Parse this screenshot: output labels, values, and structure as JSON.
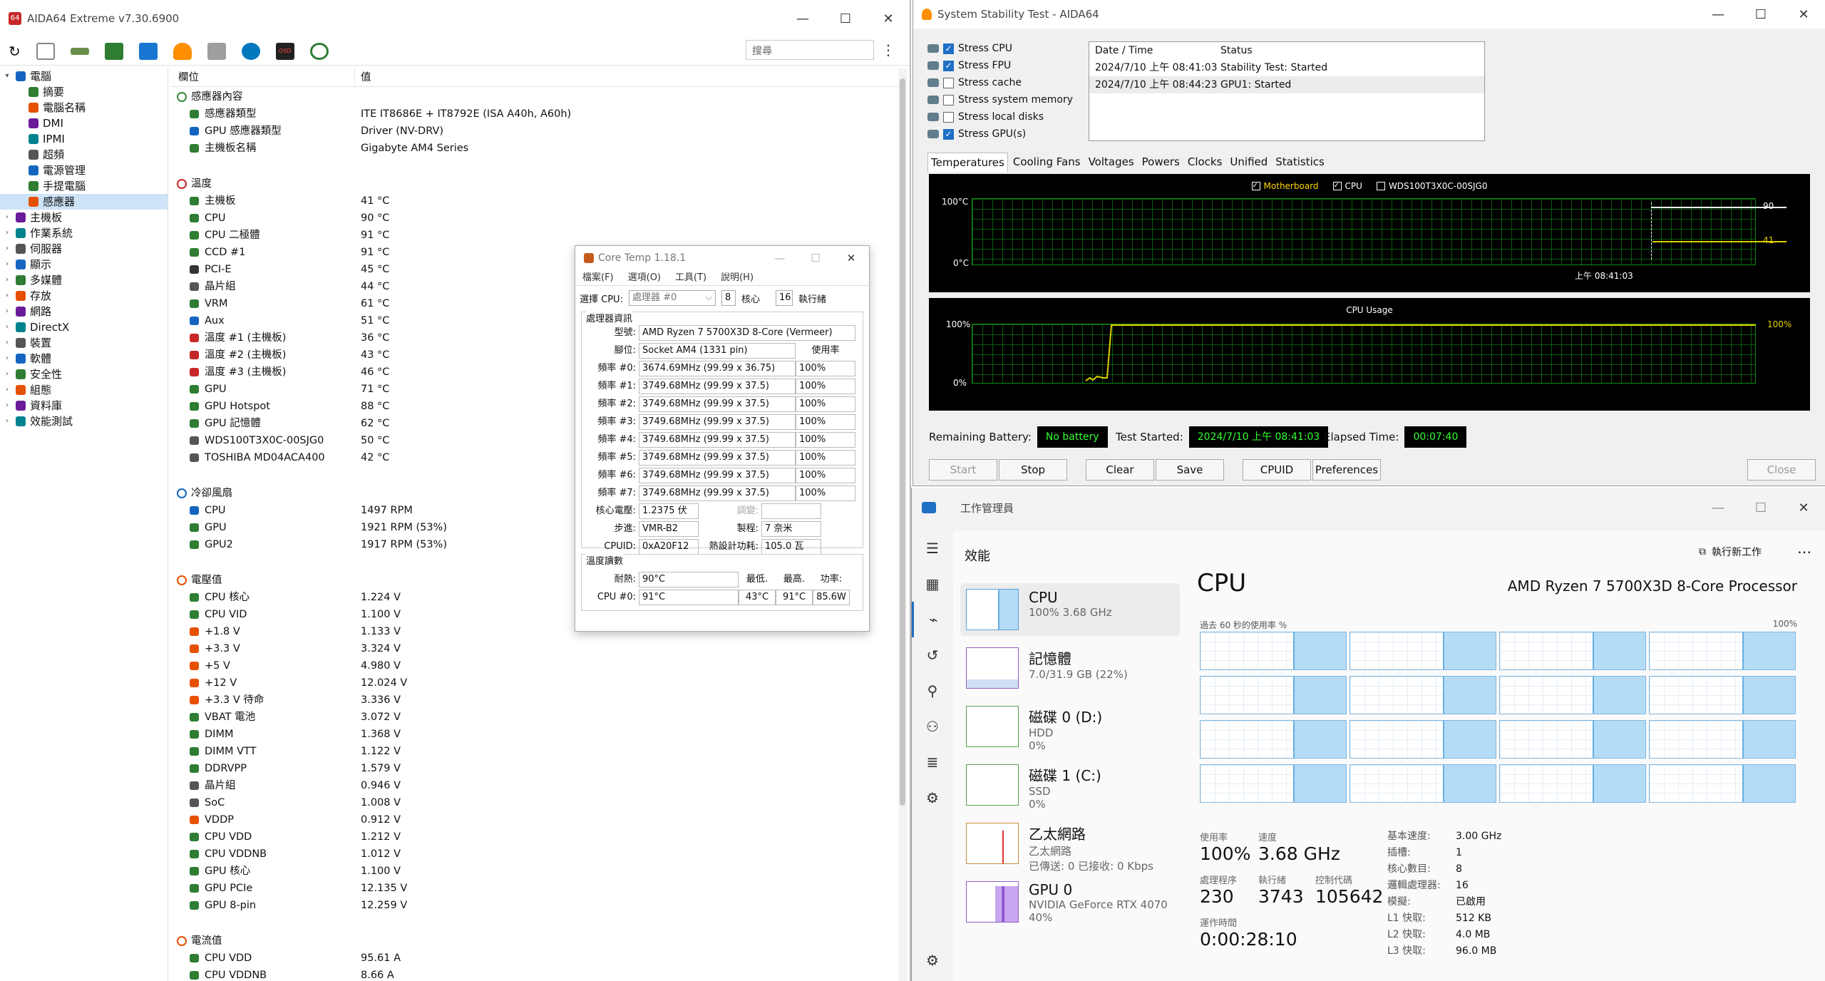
{
  "aida": {
    "title": "AIDA64 Extreme v7.30.6900",
    "search_placeholder": "搜尋",
    "col_field": "欄位",
    "col_value": "值",
    "tree": [
      {
        "label": "電腦",
        "icon": "computer-icon",
        "expand": "v",
        "indent": 0
      },
      {
        "label": "摘要",
        "icon": "summary-icon",
        "indent": 1
      },
      {
        "label": "電腦名稱",
        "icon": "computer-name-icon",
        "indent": 1
      },
      {
        "label": "DMI",
        "icon": "dmi-icon",
        "indent": 1
      },
      {
        "label": "IPMI",
        "icon": "ipmi-icon",
        "indent": 1
      },
      {
        "label": "超頻",
        "icon": "overclock-icon",
        "indent": 1
      },
      {
        "label": "電源管理",
        "icon": "power-icon",
        "indent": 1
      },
      {
        "label": "手提電腦",
        "icon": "laptop-icon",
        "indent": 1
      },
      {
        "label": "感應器",
        "icon": "sensor-icon",
        "indent": 1,
        "selected": true
      },
      {
        "label": "主機板",
        "icon": "motherboard-icon",
        "expand": ">",
        "indent": 0
      },
      {
        "label": "作業系統",
        "icon": "windows-icon",
        "expand": ">",
        "indent": 0
      },
      {
        "label": "伺服器",
        "icon": "server-icon",
        "expand": ">",
        "indent": 0
      },
      {
        "label": "顯示",
        "icon": "display-icon",
        "expand": ">",
        "indent": 0
      },
      {
        "label": "多媒體",
        "icon": "multimedia-icon",
        "expand": ">",
        "indent": 0
      },
      {
        "label": "存放",
        "icon": "storage-icon",
        "expand": ">",
        "indent": 0
      },
      {
        "label": "網路",
        "icon": "network-icon",
        "expand": ">",
        "indent": 0
      },
      {
        "label": "DirectX",
        "icon": "directx-icon",
        "expand": ">",
        "indent": 0
      },
      {
        "label": "裝置",
        "icon": "devices-icon",
        "expand": ">",
        "indent": 0
      },
      {
        "label": "軟體",
        "icon": "software-icon",
        "expand": ">",
        "indent": 0
      },
      {
        "label": "安全性",
        "icon": "security-icon",
        "expand": ">",
        "indent": 0
      },
      {
        "label": "組態",
        "icon": "config-icon",
        "expand": ">",
        "indent": 0
      },
      {
        "label": "資料庫",
        "icon": "database-icon",
        "expand": ">",
        "indent": 0
      },
      {
        "label": "效能測試",
        "icon": "benchmark-icon",
        "expand": ">",
        "indent": 0
      }
    ],
    "groups": [
      {
        "title": "感應器內容",
        "icon": "sensor-icon",
        "color": "#3a8a3a",
        "rows": [
          [
            "感應器類型",
            "ITE IT8686E + IT8792E  (ISA A40h, A60h)",
            "#2e7d32"
          ],
          [
            "GPU 感應器類型",
            "Driver  (NV-DRV)",
            "#1565c0"
          ],
          [
            "主機板名稱",
            "Gigabyte AM4 Series",
            "#2e7d32"
          ]
        ]
      },
      {
        "title": "溫度",
        "icon": "thermometer-icon",
        "color": "#c62828",
        "rows": [
          [
            "主機板",
            "41 °C",
            "#2e7d32"
          ],
          [
            "CPU",
            "90 °C",
            "#2e7d32"
          ],
          [
            "CPU 二極體",
            "91 °C",
            "#2e7d32"
          ],
          [
            "CCD #1",
            "91 °C",
            "#2e7d32"
          ],
          [
            "PCI-E",
            "45 °C",
            "#333"
          ],
          [
            "晶片組",
            "44 °C",
            "#555"
          ],
          [
            "VRM",
            "61 °C",
            "#2e7d32"
          ],
          [
            "Aux",
            "51 °C",
            "#1565c0"
          ],
          [
            "溫度 #1 (主機板)",
            "36 °C",
            "#c62828"
          ],
          [
            "溫度 #2 (主機板)",
            "43 °C",
            "#c62828"
          ],
          [
            "溫度 #3 (主機板)",
            "46 °C",
            "#c62828"
          ],
          [
            "GPU",
            "71 °C",
            "#2e7d32"
          ],
          [
            "GPU Hotspot",
            "88 °C",
            "#2e7d32"
          ],
          [
            "GPU 記憶體",
            "62 °C",
            "#2e7d32"
          ],
          [
            "WDS100T3X0C-00SJG0",
            "50 °C",
            "#555"
          ],
          [
            "TOSHIBA MD04ACA400",
            "42 °C",
            "#555"
          ]
        ]
      },
      {
        "title": "冷卻風扇",
        "icon": "fan-icon",
        "color": "#1565c0",
        "rows": [
          [
            "CPU",
            "1497 RPM",
            "#1565c0"
          ],
          [
            "GPU",
            "1921 RPM  (53%)",
            "#2e7d32"
          ],
          [
            "GPU2",
            "1917 RPM  (53%)",
            "#2e7d32"
          ]
        ]
      },
      {
        "title": "電壓值",
        "icon": "voltage-icon",
        "color": "#e65100",
        "rows": [
          [
            "CPU 核心",
            "1.224 V",
            "#2e7d32"
          ],
          [
            "CPU VID",
            "1.100 V",
            "#2e7d32"
          ],
          [
            "+1.8 V",
            "1.133 V",
            "#e65100"
          ],
          [
            "+3.3 V",
            "3.324 V",
            "#e65100"
          ],
          [
            "+5 V",
            "4.980 V",
            "#e65100"
          ],
          [
            "+12 V",
            "12.024 V",
            "#e65100"
          ],
          [
            "+3.3 V 待命",
            "3.336 V",
            "#e65100"
          ],
          [
            "VBAT 電池",
            "3.072 V",
            "#2e7d32"
          ],
          [
            "DIMM",
            "1.368 V",
            "#2e7d32"
          ],
          [
            "DIMM VTT",
            "1.122 V",
            "#2e7d32"
          ],
          [
            "DDRVPP",
            "1.579 V",
            "#2e7d32"
          ],
          [
            "晶片組",
            "0.946 V",
            "#555"
          ],
          [
            "SoC",
            "1.008 V",
            "#555"
          ],
          [
            "VDDP",
            "0.912 V",
            "#e65100"
          ],
          [
            "CPU VDD",
            "1.212 V",
            "#2e7d32"
          ],
          [
            "CPU VDDNB",
            "1.012 V",
            "#2e7d32"
          ],
          [
            "GPU 核心",
            "1.100 V",
            "#2e7d32"
          ],
          [
            "GPU PCIe",
            "12.135 V",
            "#2e7d32"
          ],
          [
            "GPU 8-pin",
            "12.259 V",
            "#2e7d32"
          ]
        ]
      },
      {
        "title": "電流值",
        "icon": "current-icon",
        "color": "#e65100",
        "rows": [
          [
            "CPU VDD",
            "95.61 A",
            "#2e7d32"
          ],
          [
            "CPU VDDNB",
            "8.66 A",
            "#2e7d32"
          ]
        ]
      }
    ]
  },
  "coretemp": {
    "title": "Core Temp 1.18.1",
    "menu": [
      "檔案(F)",
      "選項(O)",
      "工具(T)",
      "說明(H)"
    ],
    "select_label": "選擇 CPU:",
    "select_value": "處理器 #0",
    "cores_num": "8",
    "cores_label": "核心",
    "threads_num": "16",
    "threads_label": "執行緒",
    "info_legend": "處理器資訊",
    "model_label": "型號:",
    "model_value": "AMD Ryzen 7 5700X3D 8-Core (Vermeer)",
    "socket_label": "腳位:",
    "socket_value": "Socket AM4 (1331 pin)",
    "usage_header": "使用率",
    "freqs": [
      [
        "頻率 #0:",
        "3674.69MHz (99.99 x 36.75)",
        "100%"
      ],
      [
        "頻率 #1:",
        "3749.68MHz (99.99 x 37.5)",
        "100%"
      ],
      [
        "頻率 #2:",
        "3749.68MHz (99.99 x 37.5)",
        "100%"
      ],
      [
        "頻率 #3:",
        "3749.68MHz (99.99 x 37.5)",
        "100%"
      ],
      [
        "頻率 #4:",
        "3749.68MHz (99.99 x 37.5)",
        "100%"
      ],
      [
        "頻率 #5:",
        "3749.68MHz (99.99 x 37.5)",
        "100%"
      ],
      [
        "頻率 #6:",
        "3749.68MHz (99.99 x 37.5)",
        "100%"
      ],
      [
        "頻率 #7:",
        "3749.68MHz (99.99 x 37.5)",
        "100%"
      ]
    ],
    "vcore_label": "核心電壓:",
    "vcore_value": "1.2375 伏",
    "mod_label": "調變:",
    "step_label": "步進:",
    "step_value": "VMR-B2",
    "proc_label": "製程:",
    "proc_value": "7 奈米",
    "cpuid_label": "CPUID:",
    "cpuid_value": "0xA20F12",
    "tdp_label": "熱設計功耗:",
    "tdp_value": "105.0 瓦",
    "temp_legend": "溫度讀數",
    "tj_label": "耐熱:",
    "tj_value": "90°C",
    "min_label": "最低.",
    "max_label": "最高.",
    "power_label": "功率:",
    "cpu0_label": "CPU #0:",
    "cpu0_value": "91°C",
    "cpu0_min": "43°C",
    "cpu0_max": "91°C",
    "cpu0_power": "85.6W"
  },
  "sst": {
    "title": "System Stability Test - AIDA64",
    "stress": [
      {
        "label": "Stress CPU",
        "checked": true,
        "icon": "cpu-icon"
      },
      {
        "label": "Stress FPU",
        "checked": true,
        "icon": "fpu-icon"
      },
      {
        "label": "Stress cache",
        "checked": false,
        "icon": "cache-icon"
      },
      {
        "label": "Stress system memory",
        "checked": false,
        "icon": "memory-icon"
      },
      {
        "label": "Stress local disks",
        "checked": false,
        "icon": "disk-icon"
      },
      {
        "label": "Stress GPU(s)",
        "checked": true,
        "icon": "gpu-icon"
      }
    ],
    "log_headers": [
      "Date / Time",
      "Status"
    ],
    "log": [
      [
        "2024/7/10 上午 08:41:03",
        "Stability Test: Started"
      ],
      [
        "2024/7/10 上午 08:44:23",
        "GPU1: Started"
      ]
    ],
    "tabs": [
      "Temperatures",
      "Cooling Fans",
      "Voltages",
      "Powers",
      "Clocks",
      "Unified",
      "Statistics"
    ],
    "legend": [
      {
        "label": "Motherboard",
        "color": "#ffd700"
      },
      {
        "label": "CPU",
        "color": "#ffffff"
      },
      {
        "label": "WDS100T3X0C-00SJG0",
        "color": "#ffffff"
      }
    ],
    "temp_top": "100°C",
    "temp_bottom": "0°C",
    "temp_time": "上午 08:41:03",
    "temp_val1": "90",
    "temp_val2": "41",
    "usage_title": "CPU Usage",
    "usage_top": "100%",
    "usage_bottom": "0%",
    "usage_right": "100%",
    "battery_label": "Remaining Battery:",
    "battery_value": "No battery",
    "started_label": "Test Started:",
    "started_value": "2024/7/10 上午 08:41:03",
    "elapsed_label": "Elapsed Time:",
    "elapsed_value": "00:07:40",
    "buttons": {
      "start": "Start",
      "stop": "Stop",
      "clear": "Clear",
      "save": "Save",
      "cpuid": "CPUID",
      "prefs": "Preferences",
      "close": "Close"
    }
  },
  "tm": {
    "title": "工作管理員",
    "section": "效能",
    "run_task": "執行新工作",
    "perf": [
      {
        "t1": "CPU",
        "t2": "100%  3.68 GHz",
        "t3": ""
      },
      {
        "t1": "記憶體",
        "t2": "7.0/31.9 GB (22%)",
        "t3": ""
      },
      {
        "t1": "磁碟 0 (D:)",
        "t2": "HDD",
        "t3": "0%"
      },
      {
        "t1": "磁碟 1 (C:)",
        "t2": "SSD",
        "t3": "0%"
      },
      {
        "t1": "乙太網路",
        "t2": "乙太網路",
        "t3": "已傳送: 0 已接收: 0 Kbps"
      },
      {
        "t1": "GPU 0",
        "t2": "NVIDIA GeForce RTX 4070",
        "t3": "40%"
      }
    ],
    "cpu_heading": "CPU",
    "cpu_name": "AMD Ryzen 7 5700X3D 8-Core Processor",
    "graph_caption": "過去 60 秒的使用率 %",
    "graph_max": "100%",
    "stats": {
      "usage_label": "使用率",
      "usage": "100%",
      "speed_label": "速度",
      "speed": "3.68 GHz",
      "proc_label": "處理程序",
      "proc": "230",
      "threads_label": "執行緒",
      "threads": "3743",
      "handles_label": "控制代碼",
      "handles": "105642",
      "uptime_label": "運作時間",
      "uptime": "0:00:28:10"
    },
    "specs": [
      [
        "基本速度:",
        "3.00 GHz"
      ],
      [
        "插槽:",
        "1"
      ],
      [
        "核心數目:",
        "8"
      ],
      [
        "邏輯處理器:",
        "16"
      ],
      [
        "模擬:",
        "已啟用"
      ],
      [
        "L1 快取:",
        "512 KB"
      ],
      [
        "L2 快取:",
        "4.0 MB"
      ],
      [
        "L3 快取:",
        "96.0 MB"
      ]
    ]
  }
}
